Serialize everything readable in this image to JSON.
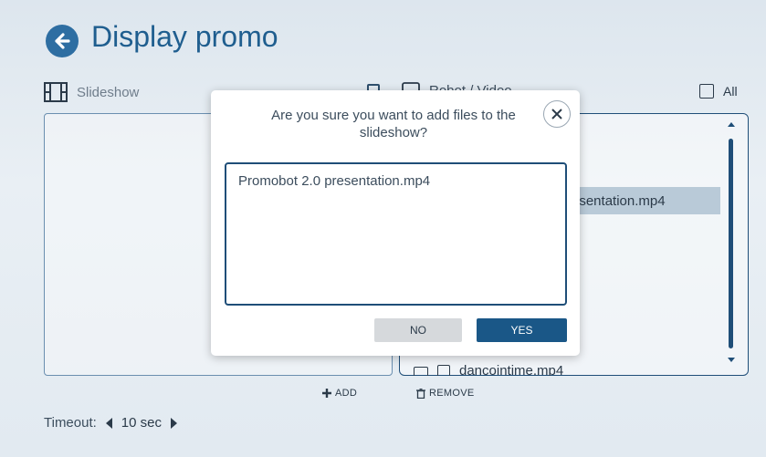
{
  "header": {
    "title": "Display promo",
    "back_icon": "arrow-left-circle-icon",
    "accent_color": "#2e6ea2"
  },
  "slideshow": {
    "label": "Slideshow",
    "icon": "film-strip-icon"
  },
  "robot_video": {
    "label": "Robot / Video",
    "icon": "monitor-icon",
    "all_label": "All",
    "selected_item": "esentation.mp4",
    "bottom_item_partial": "dancointime.mp4"
  },
  "actions": {
    "add_label": "ADD",
    "remove_label": "REMOVE"
  },
  "timeout": {
    "label": "Timeout:",
    "value": "10 sec"
  },
  "dialog": {
    "message": "Are you sure you want to add files to the slideshow?",
    "files_text": "Promobot 2.0 presentation.mp4",
    "no_label": "NO",
    "yes_label": "YES",
    "primary_color": "#1a5787"
  }
}
